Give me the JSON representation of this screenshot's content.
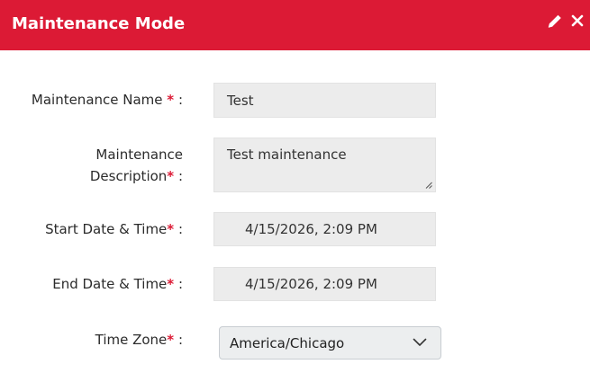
{
  "dialog": {
    "title": "Maintenance Mode",
    "header_color": "#dc1a35",
    "icons": {
      "edit": "pencil-icon",
      "close": "close-icon"
    }
  },
  "form": {
    "name": {
      "label": "Maintenance Name",
      "required_mark": "*",
      "suffix": ":",
      "value": "Test"
    },
    "description": {
      "label_line1": "Maintenance",
      "label_line2": "Description",
      "required_mark": "*",
      "suffix": ":",
      "value": "Test maintenance"
    },
    "start": {
      "label": "Start Date & Time",
      "required_mark": "*",
      "suffix": ":",
      "value": "4/15/2026, 2:09 PM"
    },
    "end": {
      "label": "End Date & Time",
      "required_mark": "*",
      "suffix": ":",
      "value": "4/15/2026, 2:09 PM"
    },
    "timezone": {
      "label": "Time Zone",
      "required_mark": "*",
      "suffix": ":",
      "selected": "America/Chicago"
    }
  }
}
